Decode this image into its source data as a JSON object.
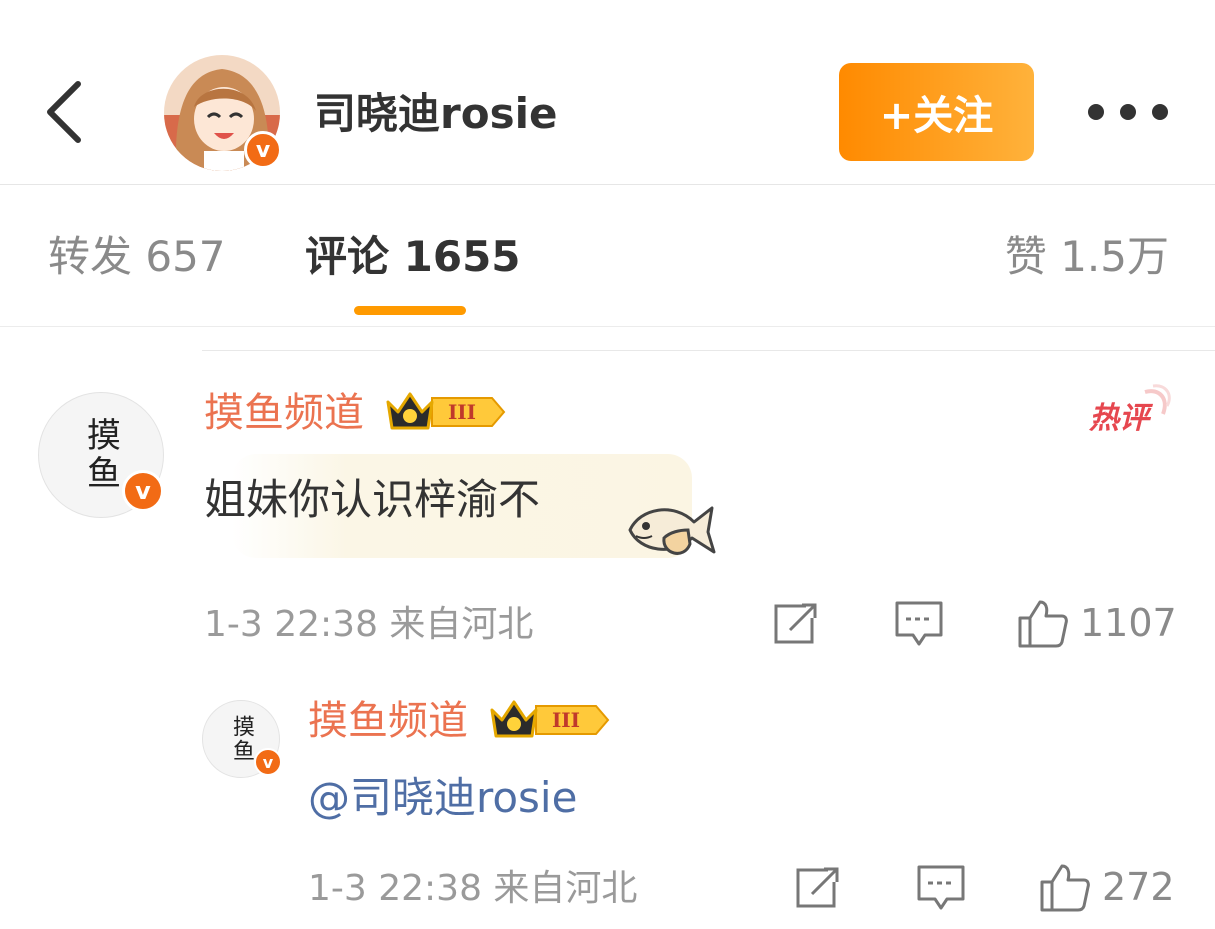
{
  "header": {
    "username": "司晓迪rosie",
    "follow_label": "+关注",
    "verified_mark": "v"
  },
  "tabs": {
    "repost": "转发 657",
    "comment": "评论 1655",
    "likes": "赞 1.5万"
  },
  "comments": [
    {
      "avatar_text": "摸鱼",
      "author": "摸鱼频道",
      "level_badge": "III",
      "hot_label": "热评",
      "text": "姐妹你认识梓渝不",
      "meta": "1-3 22:38 来自河北",
      "like_count": "1107"
    },
    {
      "avatar_text": "摸鱼",
      "author": "摸鱼频道",
      "level_badge": "III",
      "text": "@司晓迪rosie",
      "meta": "1-3 22:38 来自河北",
      "like_count": "272"
    }
  ],
  "colors": {
    "accent_orange": "#ff9a00",
    "username_orange": "#eb7350",
    "mention_blue": "#4f6ea5",
    "verified_orange": "#f26b15"
  },
  "icons": [
    "back-arrow-icon",
    "more-icon",
    "verified-icon",
    "crown-badge-icon",
    "hot-comment-icon",
    "fish-sticker-icon",
    "share-icon",
    "reply-icon",
    "like-icon"
  ]
}
